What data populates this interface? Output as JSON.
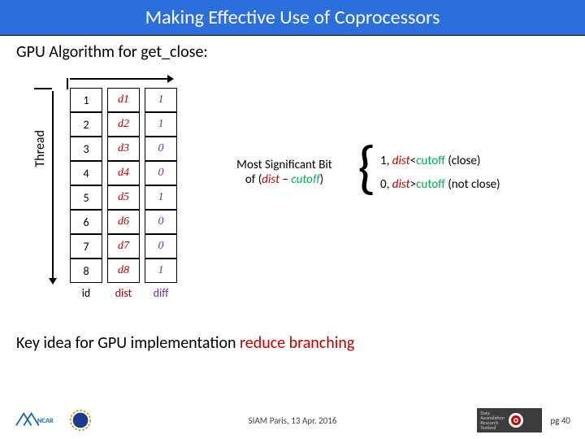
{
  "title": "Making Effective Use of Coprocessors",
  "subtitle": "GPU Algorithm for get_close:",
  "threadLabel": "Thread",
  "rows": [
    {
      "id": "1",
      "dist": "d1",
      "diff": "1"
    },
    {
      "id": "2",
      "dist": "d2",
      "diff": "1"
    },
    {
      "id": "3",
      "dist": "d3",
      "diff": "0"
    },
    {
      "id": "4",
      "dist": "d4",
      "diff": "0"
    },
    {
      "id": "5",
      "dist": "d5",
      "diff": "1"
    },
    {
      "id": "6",
      "dist": "d6",
      "diff": "0"
    },
    {
      "id": "7",
      "dist": "d7",
      "diff": "0"
    },
    {
      "id": "8",
      "dist": "d8",
      "diff": "1"
    }
  ],
  "headers": {
    "id": "id",
    "dist": "dist",
    "diff": "diff"
  },
  "explain": {
    "line1": "Most Significant Bit",
    "of": "of (",
    "dist": "dist",
    "dash": " – ",
    "cutoff": "cutoff",
    "close": ")"
  },
  "legend": {
    "l1a": "1, ",
    "l1b": "dist",
    "l1c": "<",
    "l1d": "cutoff",
    "l1e": " (close)",
    "l2a": "0, ",
    "l2b": "dist",
    "l2c": ">",
    "l2d": "cutoff",
    "l2e": " (not close)"
  },
  "keyIdea": {
    "a": "Key idea for GPU implementation ",
    "b": "reduce branching"
  },
  "footer": {
    "conf": "SIAM Paris, 13 Apr. 2016",
    "page": "pg 40",
    "dartText": "Data\nAssimilation\nResearch\nTestbed"
  }
}
